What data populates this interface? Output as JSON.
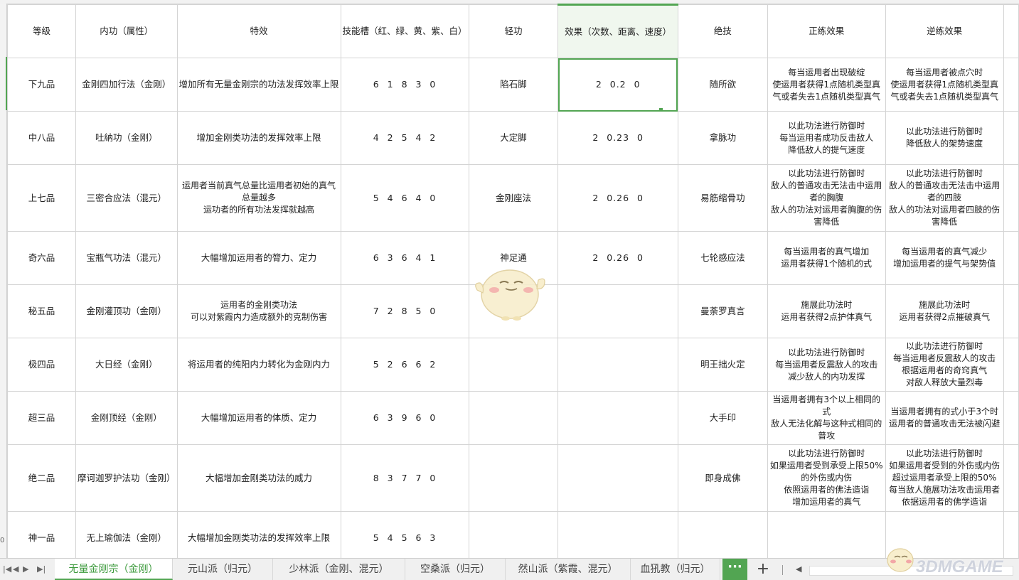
{
  "headers": [
    "等级",
    "内功（属性）",
    "特效",
    "技能槽（红、绿、黄、紫、白）",
    "轻功",
    "效果（次数、距离、速度）",
    "绝技",
    "正练效果",
    "逆练效果"
  ],
  "rows": [
    {
      "rownum": "",
      "cells": [
        "下九品",
        "金刚四加行法（金刚）",
        "增加所有无量金刚宗的功法发挥效率上限",
        "6 1 8 3 0",
        "陷石脚",
        "2 0.2 0",
        "随所欲",
        "每当运用者出现破绽\n使运用者获得1点随机类型真气或者失去1点随机类型真气",
        "每当运用者被点穴时\n使运用者获得1点随机类型真气或者失去1点随机类型真气"
      ]
    },
    {
      "rownum": "",
      "cells": [
        "中八品",
        "吐納功（金刚）",
        "增加金刚类功法的发挥效率上限",
        "4 2 5 4 2",
        "大定脚",
        "2 0.23 0",
        "拿脉功",
        "以此功法进行防御时\n每当运用者成功反击敌人\n降低敌人的提气速度",
        "以此功法进行防御时\n降低敌人的架势速度"
      ]
    },
    {
      "rownum": "",
      "cells": [
        "上七品",
        "三密合应法（混元）",
        "运用者当前真气总量比运用者初始的真气总量越多\n运功者的所有功法发挥就越高",
        "5 4 6 4 0",
        "金刚座法",
        "2 0.26 0",
        "易筋缩骨功",
        "以此功法进行防御时\n敌人的普通攻击无法击中运用者的胸腹\n敌人的功法对运用者胸腹的伤害降低",
        "以此功法进行防御时\n敌人的普通攻击无法击中运用者的四肢\n敌人的功法对运用者四肢的伤害降低"
      ]
    },
    {
      "rownum": "",
      "cells": [
        "奇六品",
        "宝瓶气功法（混元）",
        "大幅增加运用者的膂力、定力",
        "6 3 6 4 1",
        "神足通",
        "2 0.26 0",
        "七轮感应法",
        "每当运用者的真气增加\n运用者获得1个随机的式",
        "每当运用者的真气减少\n增加运用者的提气与架势值"
      ]
    },
    {
      "rownum": "",
      "cells": [
        "秘五品",
        "金刚灌顶功（金刚）",
        "运用者的金刚类功法\n可以对紫霞内力造成额外的克制伤害",
        "7 2 8 5 0",
        "",
        "",
        "曼荼罗真言",
        "施展此功法时\n运用者获得2点护体真气",
        "施展此功法时\n运用者获得2点摧破真气"
      ]
    },
    {
      "rownum": "",
      "cells": [
        "极四品",
        "大日经（金刚）",
        "将运用者的纯阳内力转化为金刚内力",
        "5 2 6 6 2",
        "",
        "",
        "明王拙火定",
        "以此功法进行防御时\n每当运用者反震敌人的攻击\n减少敌人的内功发挥",
        "以此功法进行防御时\n每当运用者反震敌人的攻击\n根据运用者的奇窍真气\n对敌人释放大量烈毒"
      ]
    },
    {
      "rownum": "",
      "cells": [
        "超三品",
        "金刚顶经（金刚）",
        "大幅增加运用者的体质、定力",
        "6 3 9 6 0",
        "",
        "",
        "大手印",
        "当运用者拥有3个以上相同的式\n敌人无法化解与这种式相同的普攻",
        "当运用者拥有的式小于3个时\n运用者的普通攻击无法被闪避"
      ]
    },
    {
      "rownum": "",
      "cells": [
        "绝二品",
        "摩诃迦罗护法功（金刚）",
        "大幅增加金刚类功法的威力",
        "8 3 7 7 0",
        "",
        "",
        "即身成佛",
        "以此功法进行防御时\n如果运用者受到承受上限50%的外伤或内伤\n依照运用者的佛法造诣\n增加运用者的真气",
        "以此功法进行防御时\n如果运用者受到的外伤或内伤超过运用者承受上限的50%\n每当敌人施展功法攻击运用者\n依据运用者的佛学造诣"
      ]
    },
    {
      "rownum": "0",
      "cells": [
        "神一品",
        "无上瑜伽法（金刚）",
        "大幅增加金刚类功法的发挥效率上限",
        "5 4 5 6 3",
        "",
        "",
        "",
        "",
        ""
      ]
    }
  ],
  "tabs": [
    "无量金刚宗（金刚）",
    "元山派（归元）",
    "少林派（金刚、混元）",
    "空桑派（归元）",
    "然山派（紫霞、混元）",
    "血犼教（归元）"
  ],
  "more_label": "···",
  "add_label": "+",
  "watermark": "3DMGAME",
  "colors": {
    "accent": "#52a552",
    "grid": "#d4d4d4",
    "tabbar": "#f0f0f0"
  }
}
